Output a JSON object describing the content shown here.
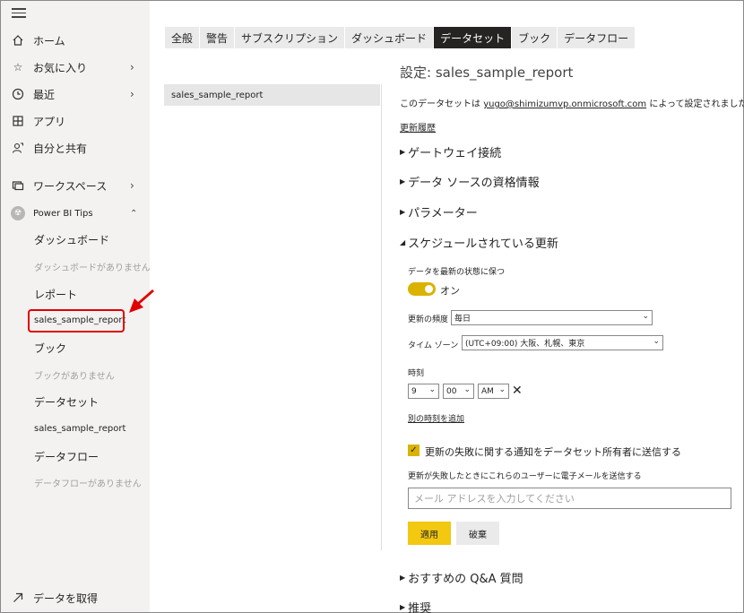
{
  "sidebar": {
    "nav": [
      {
        "label": "ホーム",
        "icon": "home-icon",
        "chevron": false
      },
      {
        "label": "お気に入り",
        "icon": "star-icon",
        "chevron": true
      },
      {
        "label": "最近",
        "icon": "clock-icon",
        "chevron": true
      },
      {
        "label": "アプリ",
        "icon": "apps-icon",
        "chevron": false
      },
      {
        "label": "自分と共有",
        "icon": "share-icon",
        "chevron": false
      },
      {
        "label": "ワークスペース",
        "icon": "workspace-icon",
        "chevron": true
      }
    ],
    "workspace": {
      "name": "Power BI Tips",
      "items": [
        {
          "label": "ダッシュボード"
        },
        {
          "label": "ダッシュボードがありません"
        },
        {
          "label": "レポート"
        },
        {
          "label": "sales_sample_report"
        },
        {
          "label": "ブック"
        },
        {
          "label": "ブックがありません"
        },
        {
          "label": "データセット"
        },
        {
          "label": "sales_sample_report"
        },
        {
          "label": "データフロー"
        },
        {
          "label": "データフローがありません"
        }
      ]
    },
    "get_data": "データを取得"
  },
  "tabs": [
    {
      "label": "全般",
      "active": false
    },
    {
      "label": "警告",
      "active": false
    },
    {
      "label": "サブスクリプション",
      "active": false
    },
    {
      "label": "ダッシュボード",
      "active": false
    },
    {
      "label": "データセット",
      "active": true
    },
    {
      "label": "ブック",
      "active": false
    },
    {
      "label": "データフロー",
      "active": false
    }
  ],
  "dataset_list": [
    "sales_sample_report"
  ],
  "settings": {
    "title": "設定: sales_sample_report",
    "owner_prefix": "このデータセットは ",
    "owner_email": "yugo@shimizumvp.onmicrosoft.com",
    "owner_suffix": " によって設定されました。",
    "history_link": "更新履歴",
    "sections_top": [
      "ゲートウェイ接続",
      "データ ソースの資格情報",
      "パラメーター",
      "スケジュールされている更新"
    ],
    "keep_updated_label": "データを最新の状態に保つ",
    "toggle_label": "オン",
    "toggle_on": true,
    "frequency_label": "更新の頻度",
    "frequency_value": "毎日",
    "timezone_label": "タイム ゾーン",
    "timezone_value": "(UTC+09:00) 大阪、札幌、東京",
    "time_label": "時刻",
    "time_hour": "9",
    "time_minute": "00",
    "time_ampm": "AM",
    "add_time_link": "別の時刻を追加",
    "notify_label": "更新の失敗に関する通知をデータセット所有者に送信する",
    "notify_checked": true,
    "email_label": "更新が失敗したときにこれらのユーザーに電子メールを送信する",
    "email_placeholder": "メール アドレスを入力してください",
    "apply_button": "適用",
    "discard_button": "破棄",
    "sections_bottom": [
      "おすすめの Q&A 質問",
      "推奨"
    ]
  },
  "colors": {
    "accent": "#f2c811",
    "highlight": "#e00000",
    "active_tab": "#252423"
  }
}
